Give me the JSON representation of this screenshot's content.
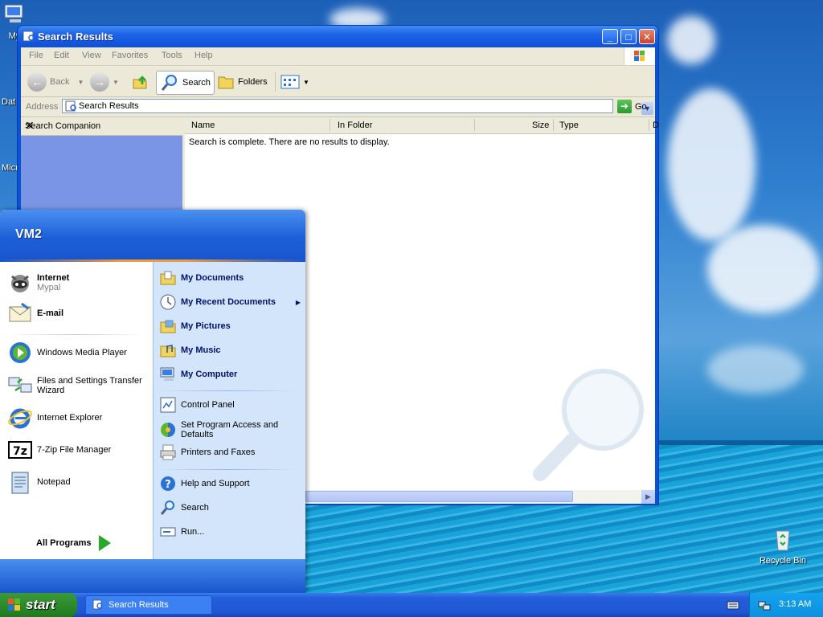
{
  "desktop": {
    "icons": [
      {
        "label": "My"
      },
      {
        "label": "Dat"
      },
      {
        "label": "Micr"
      },
      {
        "label": "Recycle Bin"
      }
    ]
  },
  "window": {
    "title": "Search Results",
    "menu": [
      "File",
      "Edit",
      "View",
      "Favorites",
      "Tools",
      "Help"
    ],
    "toolbar": {
      "back": "Back",
      "search": "Search",
      "folders": "Folders"
    },
    "address": {
      "label": "Address",
      "value": "Search Results",
      "go": "Go"
    },
    "companion_title": "Search Companion",
    "columns": [
      "Name",
      "In Folder",
      "Size",
      "Type",
      "D"
    ],
    "empty_message": "Search is complete. There are no results to display."
  },
  "start_menu": {
    "user": "VM2",
    "pinned": [
      {
        "label": "Internet",
        "sub": "Mypal"
      },
      {
        "label": "E-mail"
      }
    ],
    "recent": [
      "Windows Media Player",
      "Files and Settings Transfer Wizard",
      "Internet Explorer",
      "7-Zip File Manager",
      "Notepad"
    ],
    "all_programs": "All Programs",
    "places": [
      "My Documents",
      "My Recent Documents",
      "My Pictures",
      "My Music",
      "My Computer"
    ],
    "settings": [
      "Control Panel",
      "Set Program Access and Defaults",
      "Printers and Faxes"
    ],
    "help": [
      "Help and Support",
      "Search",
      "Run..."
    ]
  },
  "taskbar": {
    "start": "start",
    "item": "Search Results",
    "clock": "3:13 AM"
  },
  "colors": {
    "xp_blue": "#1855cd",
    "start_green": "#2e8b2e",
    "companion": "#7a95e6"
  }
}
